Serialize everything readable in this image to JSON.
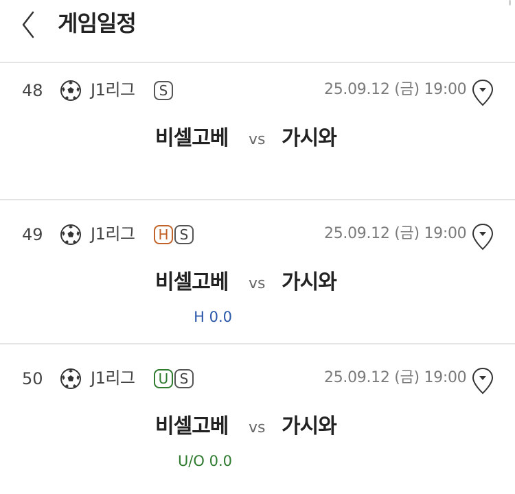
{
  "header": {
    "title": "게임일정"
  },
  "games": [
    {
      "number": "48",
      "league": "J1리그",
      "badges": [
        "S"
      ],
      "datetime": "25.09.12 (금) 19:00",
      "home": "비셀고베",
      "vs": "vs",
      "away": "가시와",
      "odds": ""
    },
    {
      "number": "49",
      "league": "J1리그",
      "badges": [
        "H",
        "S"
      ],
      "datetime": "25.09.12 (금) 19:00",
      "home": "비셀고베",
      "vs": "vs",
      "away": "가시와",
      "odds": "H 0.0"
    },
    {
      "number": "50",
      "league": "J1리그",
      "badges": [
        "U",
        "S"
      ],
      "datetime": "25.09.12 (금) 19:00",
      "home": "비셀고베",
      "vs": "vs",
      "away": "가시와",
      "odds": "U/O 0.0"
    }
  ],
  "colors": {
    "handicap_badge": "#c0622a",
    "overunder_badge": "#2e7a2e",
    "handicap_text": "#2a57a8",
    "overunder_text": "#2e7a2e"
  },
  "icons": {
    "back": "chevron-left-icon",
    "sport": "soccer-ball-icon",
    "location": "map-pin-icon"
  }
}
